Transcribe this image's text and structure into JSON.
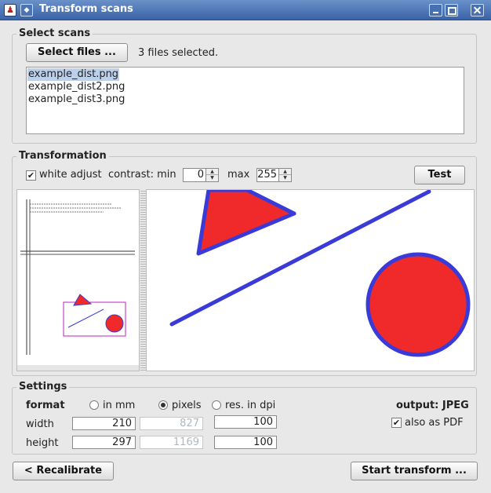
{
  "window": {
    "title": "Transform scans"
  },
  "select_scans": {
    "group_title": "Select scans",
    "select_button": "Select files ...",
    "status": "3 files selected.",
    "files": [
      "example_dist.png",
      "example_dist2.png",
      "example_dist3.png"
    ],
    "selected_index": 0
  },
  "transformation": {
    "group_title": "Transformation",
    "white_adjust_label": "white adjust",
    "white_adjust_checked": true,
    "contrast_min_label": "contrast: min",
    "contrast_min": "0",
    "max_label": "max",
    "contrast_max": "255",
    "test_button": "Test"
  },
  "settings": {
    "group_title": "Settings",
    "format_label": "format",
    "units": [
      {
        "label": "in mm",
        "selected": false
      },
      {
        "label": "pixels",
        "selected": true
      },
      {
        "label": "res. in dpi",
        "selected": false
      }
    ],
    "output_label": "output: JPEG",
    "width_label": "width",
    "height_label": "height",
    "width_mm": "210",
    "width_px": "827",
    "width_dpi": "100",
    "height_mm": "297",
    "height_px": "1169",
    "height_dpi": "100",
    "also_pdf_label": "also as PDF",
    "also_pdf_checked": true
  },
  "buttons": {
    "recalibrate": "< Recalibrate",
    "start": "Start transform ..."
  },
  "colors": {
    "shape_fill": "#f02a2a",
    "shape_stroke": "#3a3ad8",
    "selection_box": "#c020c0"
  }
}
